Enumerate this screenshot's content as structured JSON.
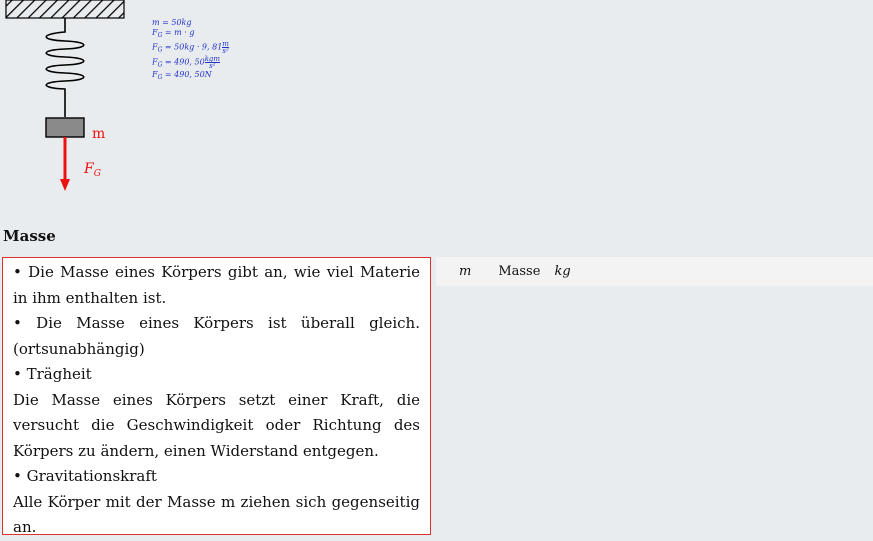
{
  "figure": {
    "mass_label": "m",
    "force_label": "F",
    "force_sub": "G",
    "colors": {
      "force": "#ee1111",
      "formula": "#2233cc",
      "mass_block": "#8a8a8a"
    }
  },
  "formulas": {
    "line1": "m = 50kg",
    "line2_prefix": "F",
    "line2_sub": "G",
    "line2_rest": " = m · g",
    "line3_prefix": "F",
    "line3_sub": "G",
    "line3_rest": " = 50kg · 9, 81",
    "line3_num": "m",
    "line3_den": "s²",
    "line4_prefix": "F",
    "line4_sub": "G",
    "line4_rest": " = 490, 50",
    "line4_num": "kgm",
    "line4_den": "s²",
    "line5_prefix": "F",
    "line5_sub": "G",
    "line5_rest": " = 490, 50N"
  },
  "heading": "Masse",
  "notes": {
    "p1": "• Die Masse eines Körpers gibt an, wie viel Materie in ihm enthalten ist.",
    "p2": "• Die Masse eines Körpers ist überall gleich. (ortsunabhängig)",
    "p3": "• Trägheit",
    "p4": "Die Masse eines Körpers setzt einer Kraft, die versucht die Geschwindigkeit oder Richtung des Körpers zu ändern, einen Widerstand entgegen.",
    "p5": "• Gravitationskraft",
    "p6": "Alle Körper mit der Masse m ziehen sich gegenseitig an."
  },
  "table": {
    "symbol": "m",
    "name": "Masse",
    "unit": "kg"
  }
}
